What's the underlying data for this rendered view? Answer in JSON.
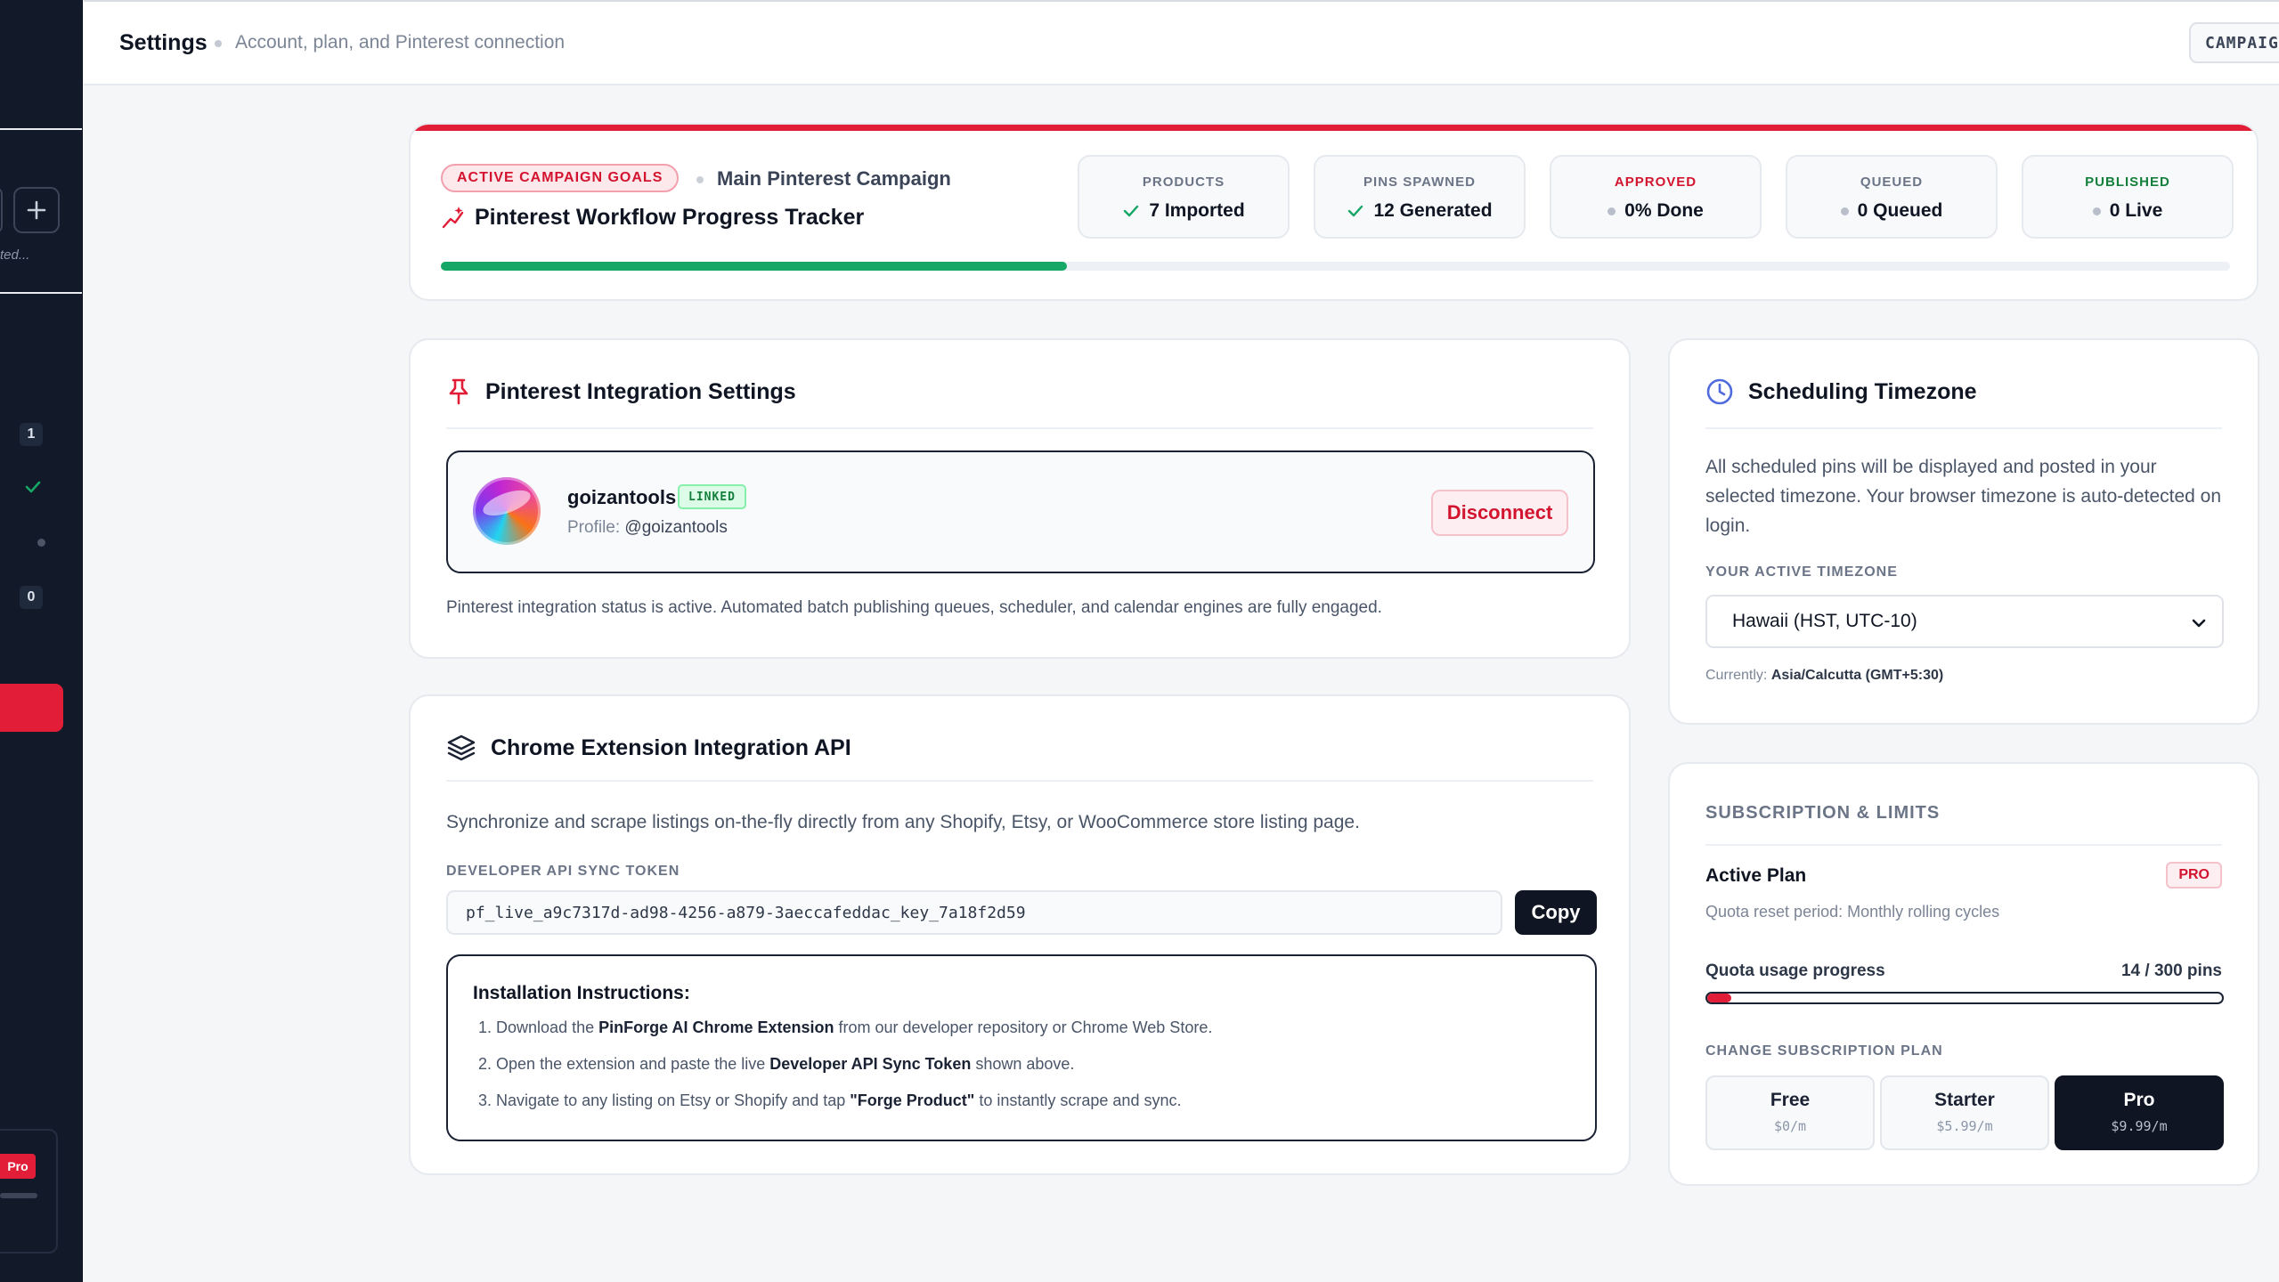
{
  "header": {
    "title": "Settings",
    "subtitle": "Account, plan, and Pinterest connection",
    "campaign_button": "CAMPAIGN"
  },
  "sidebar": {
    "truncated_text": "ted...",
    "badge_1": "1",
    "badge_2": "0",
    "pro_tag": "Pro"
  },
  "tracker": {
    "badge": "ACTIVE CAMPAIGN GOALS",
    "campaign_name": "Main Pinterest Campaign",
    "title": "Pinterest Workflow Progress Tracker",
    "progress": 0.35,
    "stats": [
      {
        "label": "PRODUCTS",
        "value": "7 Imported",
        "icon": "check-icon",
        "label_color": "#6b7587"
      },
      {
        "label": "PINS SPAWNED",
        "value": "12 Generated",
        "icon": "check-icon",
        "label_color": "#6b7587"
      },
      {
        "label": "APPROVED",
        "value": "0% Done",
        "icon": "dot-icon",
        "label_color": "#d3142f"
      },
      {
        "label": "QUEUED",
        "value": "0 Queued",
        "icon": "dot-icon",
        "label_color": "#6b7587"
      },
      {
        "label": "PUBLISHED",
        "value": "0 Live",
        "icon": "dot-icon",
        "label_color": "#15803d"
      }
    ]
  },
  "pinterest": {
    "title": "Pinterest Integration Settings",
    "account_name": "goizantools",
    "linked_badge": "LINKED",
    "profile_label": "Profile:",
    "profile_handle": "@goizantools",
    "disconnect_label": "Disconnect",
    "status_text": "Pinterest integration status is active. Automated batch publishing queues, scheduler, and calendar engines are fully engaged."
  },
  "extension": {
    "title": "Chrome Extension Integration API",
    "description": "Synchronize and scrape listings on-the-fly directly from any Shopify, Etsy, or WooCommerce store listing page.",
    "token_label": "DEVELOPER API SYNC TOKEN",
    "token_value": "pf_live_a9c7317d-ad98-4256-a879-3aeccafeddac_key_7a18f2d59",
    "copy_label": "Copy",
    "instructions_title": "Installation Instructions:",
    "steps": [
      {
        "n": "1.",
        "pre": "Download the ",
        "bold": "PinForge AI Chrome Extension",
        "post": " from our developer repository or Chrome Web Store."
      },
      {
        "n": "2.",
        "pre": "Open the extension and paste the live ",
        "bold": "Developer API Sync Token",
        "post": " shown above."
      },
      {
        "n": "3.",
        "pre": "Navigate to any listing on Etsy or Shopify and tap ",
        "bold": "\"Forge Product\"",
        "post": " to instantly scrape and sync."
      }
    ]
  },
  "timezone": {
    "title": "Scheduling Timezone",
    "description": "All scheduled pins will be displayed and posted in your selected timezone. Your browser timezone is auto-detected on login.",
    "label": "YOUR ACTIVE TIMEZONE",
    "selected": "Hawaii (HST, UTC-10)",
    "current_label": "Currently:",
    "current_value": "Asia/Calcutta (GMT+5:30)"
  },
  "subscription": {
    "heading": "SUBSCRIPTION & LIMITS",
    "plan_label": "Active Plan",
    "plan_badge": "PRO",
    "quota_reset": "Quota reset period: Monthly rolling cycles",
    "quota_label": "Quota usage progress",
    "quota_value": "14 / 300 pins",
    "quota_fraction": 0.047,
    "change_label": "CHANGE SUBSCRIPTION PLAN",
    "plans": [
      {
        "name": "Free",
        "price": "$0/m",
        "active": false
      },
      {
        "name": "Starter",
        "price": "$5.99/m",
        "active": false
      },
      {
        "name": "Pro",
        "price": "$9.99/m",
        "active": true
      }
    ]
  },
  "colors": {
    "accent_red": "#e11d37",
    "success_green": "#16a665",
    "dark": "#0f1522"
  }
}
